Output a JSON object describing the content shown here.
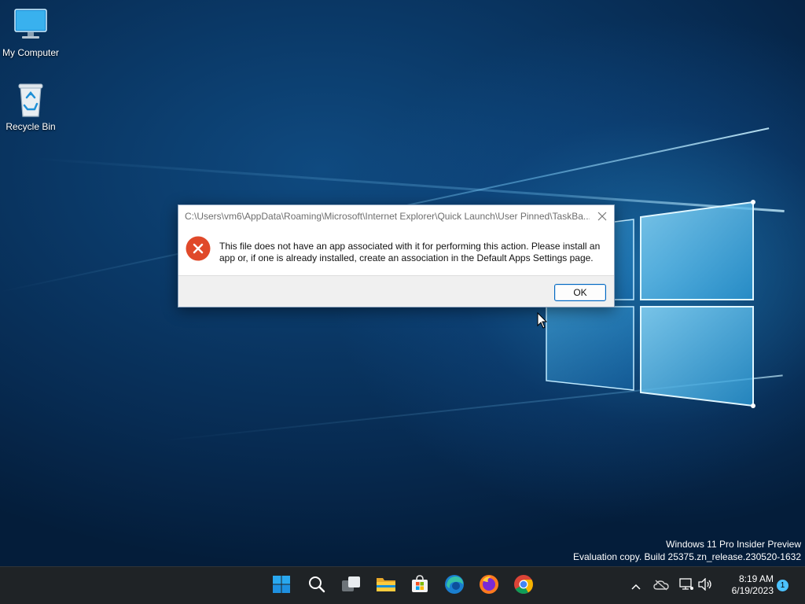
{
  "desktop": {
    "icons": [
      {
        "label": "My Computer",
        "icon": "monitor-icon"
      },
      {
        "label": "Recycle Bin",
        "icon": "recycle-bin-icon"
      }
    ],
    "watermark": {
      "line1": "Windows 11 Pro Insider Preview",
      "line2": "Evaluation copy. Build 25375.zn_release.230520-1632"
    }
  },
  "dialog": {
    "title": "C:\\Users\\vm6\\AppData\\Roaming\\Microsoft\\Internet Explorer\\Quick Launch\\User Pinned\\TaskBa...",
    "message": "This file does not have an app associated with it for performing this action. Please install an app or, if one is already installed, create an association in the Default Apps Settings page.",
    "ok_label": "OK",
    "close_icon": "close-icon",
    "status_icon": "error-icon"
  },
  "taskbar": {
    "apps": [
      {
        "name": "start",
        "icon": "windows-logo-icon"
      },
      {
        "name": "search",
        "icon": "search-icon"
      },
      {
        "name": "task-view",
        "icon": "task-view-icon"
      },
      {
        "name": "file-explorer",
        "icon": "folder-icon"
      },
      {
        "name": "microsoft-store",
        "icon": "store-icon"
      },
      {
        "name": "edge",
        "icon": "edge-icon"
      },
      {
        "name": "firefox",
        "icon": "firefox-icon"
      },
      {
        "name": "chrome",
        "icon": "chrome-icon"
      }
    ],
    "tray": {
      "icons": [
        "chevron-up-icon",
        "cloud-off-icon",
        "network-icon",
        "volume-icon"
      ],
      "time": "8:19 AM",
      "date": "6/19/2023",
      "notification_count": "1"
    }
  },
  "colors": {
    "accent": "#0067c0",
    "error_red": "#e0492a",
    "taskbar": "#1f2326"
  }
}
